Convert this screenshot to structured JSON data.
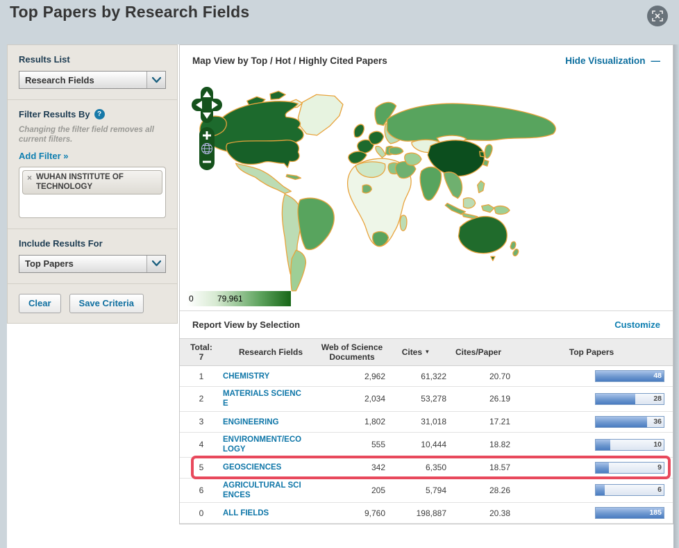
{
  "page": {
    "title": "Top Papers by Research Fields"
  },
  "sidebar": {
    "results_list_label": "Results List",
    "results_list_value": "Research Fields",
    "filter_by_label": "Filter Results By",
    "help_glyph": "?",
    "filter_note": "Changing the filter field removes all current filters.",
    "add_filter_label": "Add Filter »",
    "filters": [
      {
        "remove_glyph": "×",
        "label": "WUHAN INSTITUTE OF TECHNOLOGY"
      }
    ],
    "include_label": "Include Results For",
    "include_value": "Top Papers",
    "clear_label": "Clear",
    "save_label": "Save Criteria"
  },
  "map": {
    "header": "Map View by Top / Hot / Highly Cited Papers",
    "hide_label": "Hide Visualization",
    "hide_dash": "—",
    "zoom_in_glyph": "+",
    "zoom_out_glyph": "−",
    "scale_min": "0",
    "scale_max": "79,961",
    "scale_colors": [
      "#ffffff",
      "#176617"
    ]
  },
  "report": {
    "header": "Report View by Selection",
    "customize_label": "Customize",
    "total_label": "Total:",
    "total_value": "7",
    "col_field": "Research Fields",
    "col_docs": "Web of Science Documents",
    "col_cites": "Cites",
    "sort_glyph": "▼",
    "col_cpp": "Cites/Paper",
    "col_top": "Top Papers",
    "rows": [
      {
        "rank": "1",
        "field": "CHEMISTRY",
        "docs": "2,962",
        "cites": "61,322",
        "cpp": "20.70",
        "top": "48",
        "bar_pct": 100,
        "highlighted": false
      },
      {
        "rank": "2",
        "field": "MATERIALS SCIENCE",
        "docs": "2,034",
        "cites": "53,278",
        "cpp": "26.19",
        "top": "28",
        "bar_pct": 58,
        "highlighted": false
      },
      {
        "rank": "3",
        "field": "ENGINEERING",
        "docs": "1,802",
        "cites": "31,018",
        "cpp": "17.21",
        "top": "36",
        "bar_pct": 75,
        "highlighted": false
      },
      {
        "rank": "4",
        "field": "ENVIRONMENT/ECOLOGY",
        "docs": "555",
        "cites": "10,444",
        "cpp": "18.82",
        "top": "10",
        "bar_pct": 21,
        "highlighted": false
      },
      {
        "rank": "5",
        "field": "GEOSCIENCES",
        "docs": "342",
        "cites": "6,350",
        "cpp": "18.57",
        "top": "9",
        "bar_pct": 19,
        "highlighted": true
      },
      {
        "rank": "6",
        "field": "AGRICULTURAL SCIENCES",
        "docs": "205",
        "cites": "5,794",
        "cpp": "28.26",
        "top": "6",
        "bar_pct": 13,
        "highlighted": false
      },
      {
        "rank": "0",
        "field": "ALL FIELDS",
        "docs": "9,760",
        "cites": "198,887",
        "cpp": "20.38",
        "top": "185",
        "bar_pct": 100,
        "highlighted": false
      }
    ]
  }
}
